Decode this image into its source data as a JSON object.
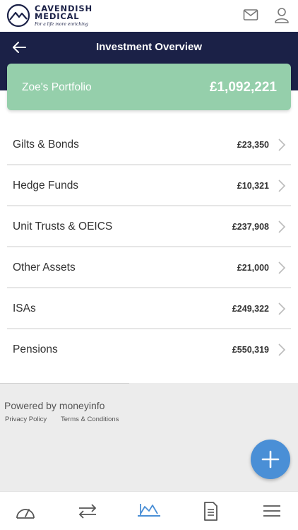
{
  "brand": {
    "name_line1": "CAVENDISH",
    "name_line2": "MEDICAL",
    "tagline": "For a life more enriching"
  },
  "header": {
    "title": "Investment Overview",
    "icons": [
      "mail-icon",
      "user-icon",
      "back-arrow-icon"
    ]
  },
  "portfolio": {
    "name": "Zoe's Portfolio",
    "total": "£1,092,221",
    "color": "#95cfab"
  },
  "assets": [
    {
      "label": "Gilts & Bonds",
      "value": "£23,350"
    },
    {
      "label": "Hedge Funds",
      "value": "£10,321"
    },
    {
      "label": "Unit Trusts & OEICS",
      "value": "£237,908"
    },
    {
      "label": "Other Assets",
      "value": "£21,000"
    },
    {
      "label": "ISAs",
      "value": "£249,322"
    },
    {
      "label": "Pensions",
      "value": "£550,319"
    }
  ],
  "footer": {
    "powered_by": "Powered by moneyinfo",
    "privacy": "Privacy Policy",
    "terms": "Terms & Conditions"
  },
  "nav": {
    "items": [
      "dashboard-icon",
      "transfer-icon",
      "chart-icon",
      "document-icon",
      "menu-icon"
    ],
    "active": "chart-icon"
  },
  "colors": {
    "navy": "#1b2147",
    "accent": "#4a8fd6",
    "portfolio_green": "#95cfab"
  }
}
